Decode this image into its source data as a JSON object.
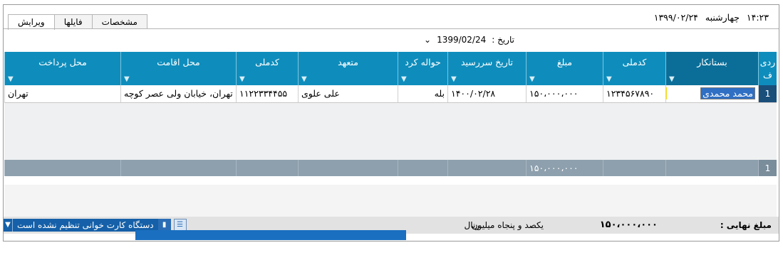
{
  "header": {
    "time": "۱۴:۲۳",
    "day": "چهارشنبه",
    "date": "۱۳۹۹/۰۲/۲۴"
  },
  "tabs": [
    {
      "label": "ویرایش"
    },
    {
      "label": "فایلها"
    },
    {
      "label": "مشخصات"
    }
  ],
  "date_filter": {
    "label": "تاریخ :",
    "value": "1399/02/24",
    "arrow": "⌄"
  },
  "grid": {
    "columns": [
      {
        "label": "ردی ف"
      },
      {
        "label": "بستانکار"
      },
      {
        "label": "کدملی"
      },
      {
        "label": "مبلغ"
      },
      {
        "label": "تاریخ سررسید"
      },
      {
        "label": "حواله کرد"
      },
      {
        "label": "متعهد"
      },
      {
        "label": "کدملی"
      },
      {
        "label": "محل اقامت"
      },
      {
        "label": "محل پرداخت"
      }
    ],
    "filter_icon": "filter-icon",
    "row": {
      "index": "1",
      "creditor": "محمد محمدی",
      "national_id": "۱۲۳۴۵۶۷۸۹۰",
      "amount": "۱۵۰،۰۰۰،۰۰۰",
      "due_date": "۱۴۰۰/۰۲/۲۸",
      "transfer": "بله",
      "obligor": "علی علوی",
      "obligor_id": "۱۱۲۲۳۳۴۴۵۵",
      "residence": "تهران، خیابان ولی عصر کوچه",
      "payment_place": "تهران"
    },
    "summary": {
      "index": "1",
      "amount_total": "۱۵۰،۰۰۰،۰۰۰"
    }
  },
  "footer": {
    "final_label": "مبلغ نهایی :",
    "final_amount": "۱۵۰،۰۰۰،۰۰۰",
    "words": "یکصد و پنجاه  میلیون",
    "currency": "ریال"
  },
  "status": {
    "message": "دستگاه کارت خوانی تنظیم نشده است"
  },
  "colors": {
    "header_bg": "#0e8dbc",
    "summary_bg": "#8ea0ad",
    "status_bg": "#1560a8"
  }
}
